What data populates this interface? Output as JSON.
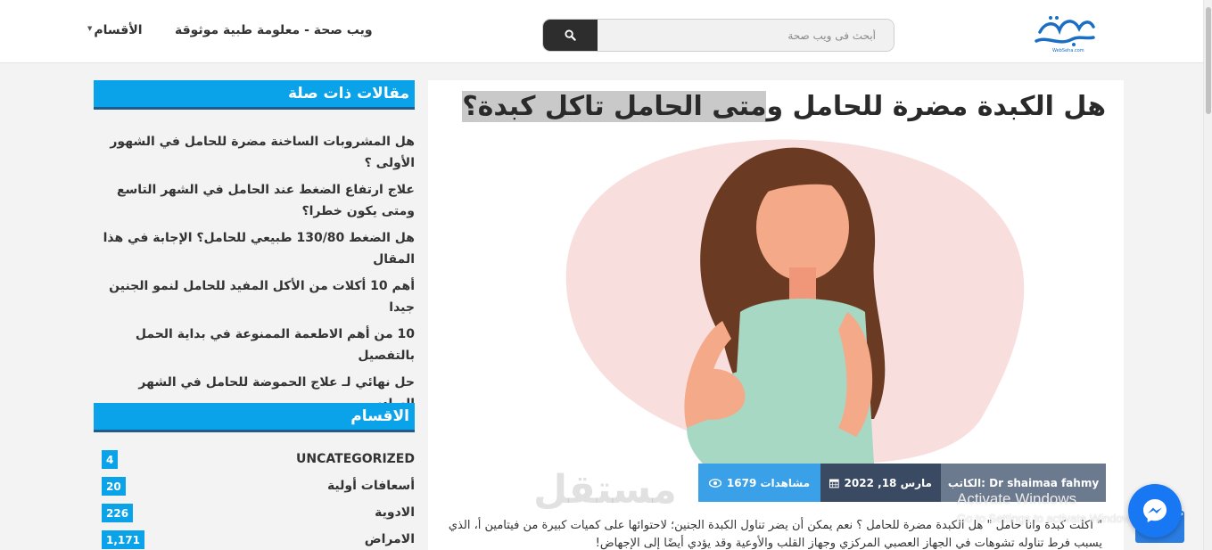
{
  "header": {
    "logo_text": "ويب صحة",
    "logo_subtext": "WebSeha.com",
    "search_placeholder": "أبحث فى ويب صحة",
    "nav_title": "ويب صحة - معلومة طبية موثوقة",
    "nav_sections": "الأقسام"
  },
  "article": {
    "title_plain": "هل الكبدة مضرة للحامل و",
    "title_highlight": "متى الحامل تاكل كبدة؟",
    "views": "1679 مشاهدات",
    "date": "مارس 18, 2022",
    "author": "الكاتب: Dr shaimaa fahmy",
    "text": "\" اكلت كبدة وانا حامل \" هل الكبدة مضرة للحامل ؟ نعم يمكن أن يضر تناول الكبدة الجنين؛ لاحتوائها على كميات كبيرة من فيتامين أ، الذي يسبب فرط تناوله تشوهات في الجهاز العصبي المركزي وجهاز القلب والأوعية وقد يؤدي أيضًا إلى الإجهاض!"
  },
  "sidebar": {
    "related_title": "مقالات ذات صلة",
    "related": [
      "هل المشروبات الساخنة مضرة للحامل في الشهور الأولى ؟",
      "علاج ارتفاع الضغط عند الحامل في الشهر التاسع ومتى يكون خطرا؟",
      "هل الضغط 130/80 طبيعي للحامل؟ الإجابة في هذا المقال",
      "أهم 10 أكلات من الأكل المفيد للحامل لنمو الجنين جيدا",
      "10 من أهم الاطعمة الممنوعة في بداية الحمل بالتفصيل",
      "حل نهائي لـ علاج الحموضة للحامل في الشهر السادس"
    ],
    "categories_title": "الاقسام",
    "categories": [
      {
        "name": "UNCATEGORIZED",
        "count": "4"
      },
      {
        "name": "أسعافات أولية",
        "count": "20"
      },
      {
        "name": "الادوية",
        "count": "226"
      },
      {
        "name": "الامراض",
        "count": "1,171"
      }
    ]
  },
  "overlays": {
    "watermark": "مستقل",
    "windows_title": "Activate Windows",
    "windows_sub": "Go to Settings to activate Windows."
  }
}
